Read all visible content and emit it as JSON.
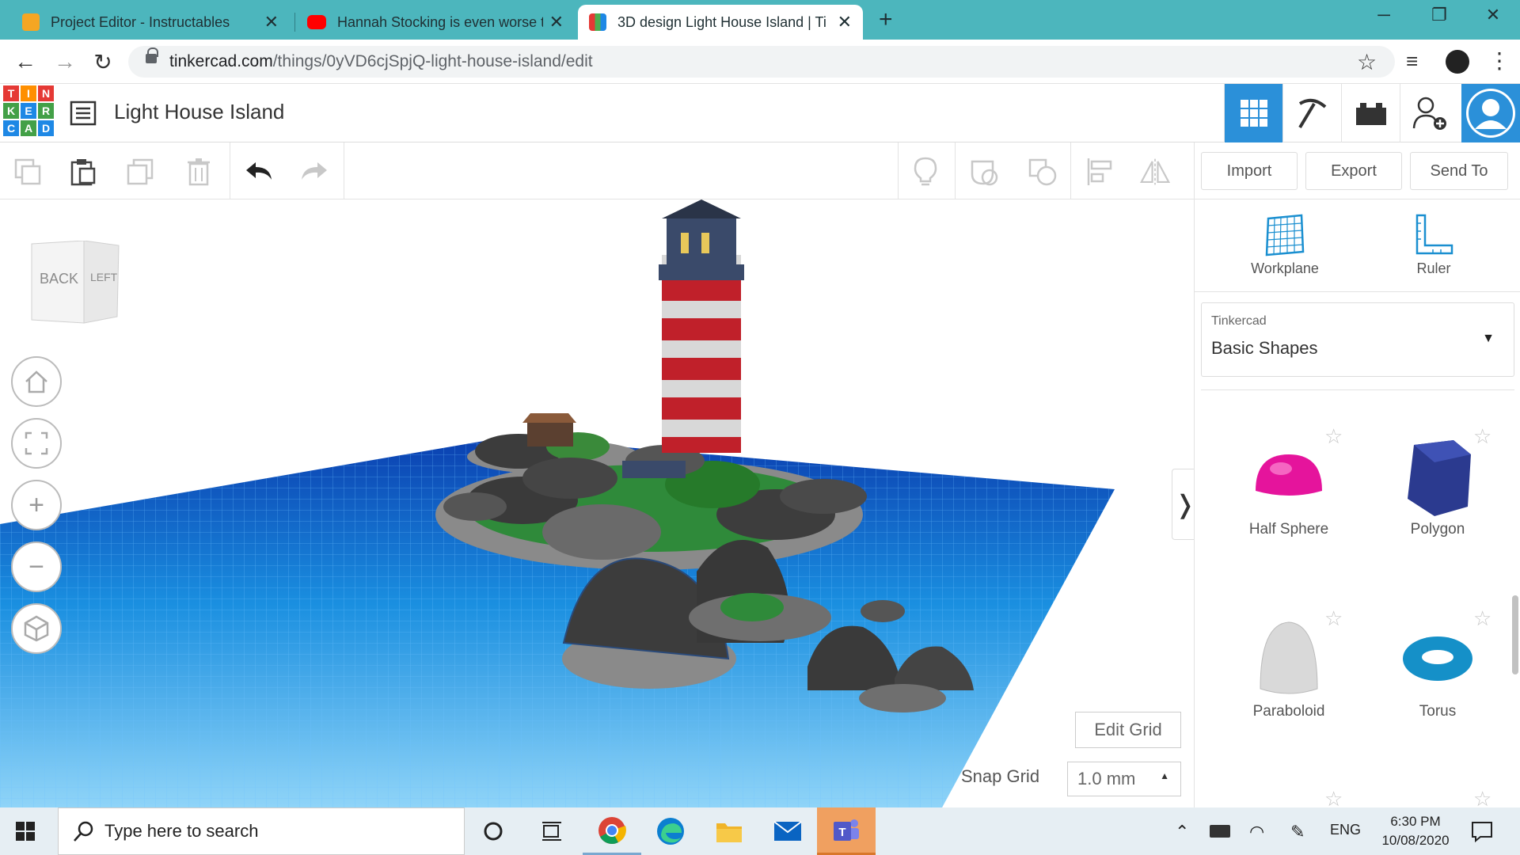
{
  "browser": {
    "tabs": [
      {
        "title": "Project Editor - Instructables",
        "active": false
      },
      {
        "title": "Hannah Stocking is even worse th",
        "active": false
      },
      {
        "title": "3D design Light House Island | Ti",
        "active": true
      }
    ],
    "url_host": "tinkercad.com",
    "url_path": "/things/0yVD6cjSpjQ-light-house-island/edit"
  },
  "app": {
    "logo_letters": [
      "T",
      "I",
      "N",
      "K",
      "E",
      "R",
      "C",
      "A",
      "D"
    ],
    "design_title": "Light House Island"
  },
  "toolbar": {
    "import_label": "Import",
    "export_label": "Export",
    "send_to_label": "Send To"
  },
  "viewport": {
    "view_cube_front": "BACK",
    "view_cube_side": "LEFT",
    "edit_grid_label": "Edit Grid",
    "snap_grid_label": "Snap Grid",
    "snap_grid_value": "1.0 mm"
  },
  "panel": {
    "workplane_label": "Workplane",
    "ruler_label": "Ruler",
    "library_source": "Tinkercad",
    "library_name": "Basic Shapes",
    "shapes": [
      {
        "name": "Half Sphere",
        "color": "#e5149c"
      },
      {
        "name": "Polygon",
        "color": "#2b3a8f"
      },
      {
        "name": "Paraboloid",
        "color": "#d9d9d9"
      },
      {
        "name": "Torus",
        "color": "#1590c8"
      }
    ]
  },
  "taskbar": {
    "search_placeholder": "Type here to search",
    "language": "ENG",
    "time": "6:30 PM",
    "date": "10/08/2020"
  },
  "colors": {
    "chrome_tabstrip": "#4cb6bd",
    "tinkercad_blue": "#2b90d9",
    "grid_blue": "#1a8fe0"
  }
}
